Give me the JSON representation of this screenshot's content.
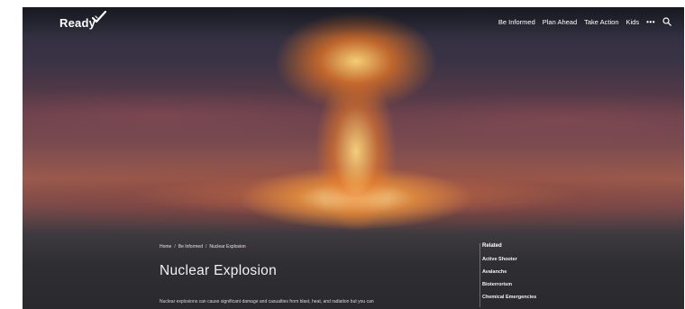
{
  "header": {
    "logo_text": "Ready",
    "nav": [
      {
        "label": "Be Informed"
      },
      {
        "label": "Plan Ahead"
      },
      {
        "label": "Take Action"
      },
      {
        "label": "Kids"
      }
    ],
    "more_label": "•••",
    "search_icon": "search-icon"
  },
  "breadcrumb": [
    {
      "label": "Home"
    },
    {
      "label": "Be Informed"
    },
    {
      "label": "Nuclear Explosion"
    }
  ],
  "breadcrumb_separator": "/",
  "page_title": "Nuclear Explosion",
  "intro_text": "Nuclear explosions can cause significant damage and casualties from blast, heat, and radiation but you can",
  "related": {
    "heading": "Related",
    "items": [
      {
        "label": "Active Shooter"
      },
      {
        "label": "Avalanche"
      },
      {
        "label": "Bioterrorism"
      },
      {
        "label": "Chemical Emergencies"
      }
    ]
  },
  "colors": {
    "text": "#ffffff",
    "sky_top": "#2a2c3a",
    "fireball": "#ffd678"
  }
}
